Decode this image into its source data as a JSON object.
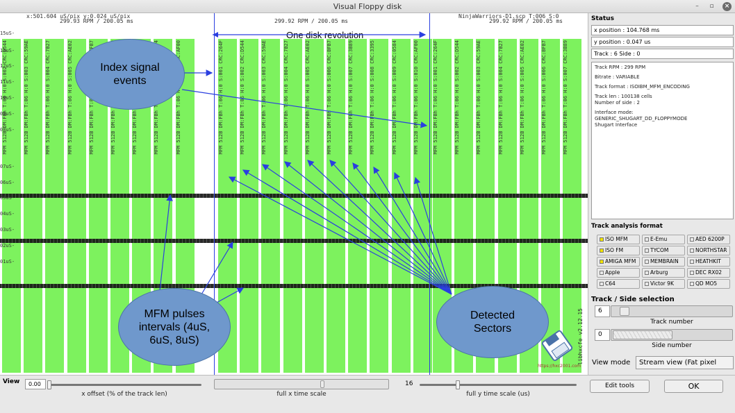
{
  "window": {
    "title": "Visual Floppy disk"
  },
  "track_view": {
    "x_info": "x:501.604 uS/pix y:0.024 uS/pix",
    "rpm_left": "299.93 RPM / 200.05 ms",
    "rpm_mid": "299.92 RPM / 200.05 ms",
    "file_info": "NinjaWarriors-D1.scp T:006 S:0",
    "rpm_right": "299.92 RPM / 200.05 ms",
    "revolution_label": "One disk revolution",
    "y_scale": [
      "15uS-",
      "13uS-",
      "12uS-",
      "11uS-",
      "10uS-",
      "09uS-",
      "08uS-",
      "07uS-",
      "06uS-",
      "05uS-",
      "04uS-",
      "03uS-",
      "02uS-",
      "01uS-"
    ],
    "sector_labels": [
      "MFM 512B DM:FBh T:06 H:0 S:001 CRC:264F",
      "MFM 512B DM:FBh T:06 H:0 S:002 CRC:D544",
      "MFM 512B DM:FBh T:06 H:0 S:003 CRC:59AE",
      "MFM 512B DM:FBh T:06 H:0 S:004 CRC:7B27",
      "MFM 512B DM:FBh T:06 H:0 S:005 CRC:AE02",
      "MFM 512B DM:FBh T:06 H:0 S:006 CRC:BFB7",
      "MFM 512B DM:FBh T:06 H:0 S:007 CRC:3B89",
      "MFM 512B DM:FBh T:06 H:0 S:008 CRC:3395",
      "MFM 512B DM:FBh T:06 H:0 S:009 CRC:0584",
      "MFM 512B DM:FBh T:06 H:0 S:010 CRC:AF00"
    ],
    "version": "libhxcfe v2.12.15",
    "logo_url": "https://hxc2001.com"
  },
  "annotations": {
    "index": "Index signal events",
    "mfm": "MFM pulses intervals (4uS, 6uS, 8uS)",
    "sectors": "Detected Sectors"
  },
  "status": {
    "title": "Status",
    "x_position": "x position : 104.768 ms",
    "y_position": "y position : 0.047 us",
    "track_side": "Track : 6 Side : 0",
    "details": [
      "Track RPM : 299 RPM",
      "",
      "Bitrate : VARIABLE",
      "",
      "Track format : ISOIBM_MFM_ENCODING",
      "",
      "Track len : 100138 cells",
      "Number of side : 2",
      "",
      "Interface mode:",
      "GENERIC_SHUGART_DD_FLOPPYMODE",
      "Shugart Interface"
    ]
  },
  "track_analysis": {
    "title": "Track analysis format",
    "formats": [
      {
        "label": "ISO MFM",
        "checked": true
      },
      {
        "label": "E-Emu",
        "checked": false
      },
      {
        "label": "AED 6200P",
        "checked": false
      },
      {
        "label": "ISO FM",
        "checked": true
      },
      {
        "label": "TYCOM",
        "checked": false
      },
      {
        "label": "NORTHSTAR",
        "checked": false
      },
      {
        "label": "AMIGA MFM",
        "checked": true
      },
      {
        "label": "MEMBRAIN",
        "checked": false
      },
      {
        "label": "HEATHKIT",
        "checked": false
      },
      {
        "label": "Apple",
        "checked": false
      },
      {
        "label": "Arburg",
        "checked": false
      },
      {
        "label": "DEC RX02",
        "checked": false
      },
      {
        "label": "C64",
        "checked": false
      },
      {
        "label": "Victor 9K",
        "checked": false
      },
      {
        "label": "QD MO5",
        "checked": false
      }
    ]
  },
  "track_side": {
    "title": "Track / Side selection",
    "track_value": "6",
    "track_label": "Track number",
    "side_value": "0",
    "side_label": "Side number",
    "view_mode_label": "View mode",
    "view_mode_value": "Stream view (Fat pixel"
  },
  "bottom": {
    "view_label": "View",
    "x_offset_value": "0.00",
    "x_offset_label": "x offset (% of the track len)",
    "x_time_label": "full x time scale",
    "y_value": "16",
    "y_time_label": "full y time scale (us)",
    "edit_tools": "Edit tools",
    "ok": "OK"
  },
  "colors": {
    "sector_green": "#7df25e",
    "bubble_blue": "#6f98cc",
    "arrow_blue": "#2a3fe0"
  }
}
